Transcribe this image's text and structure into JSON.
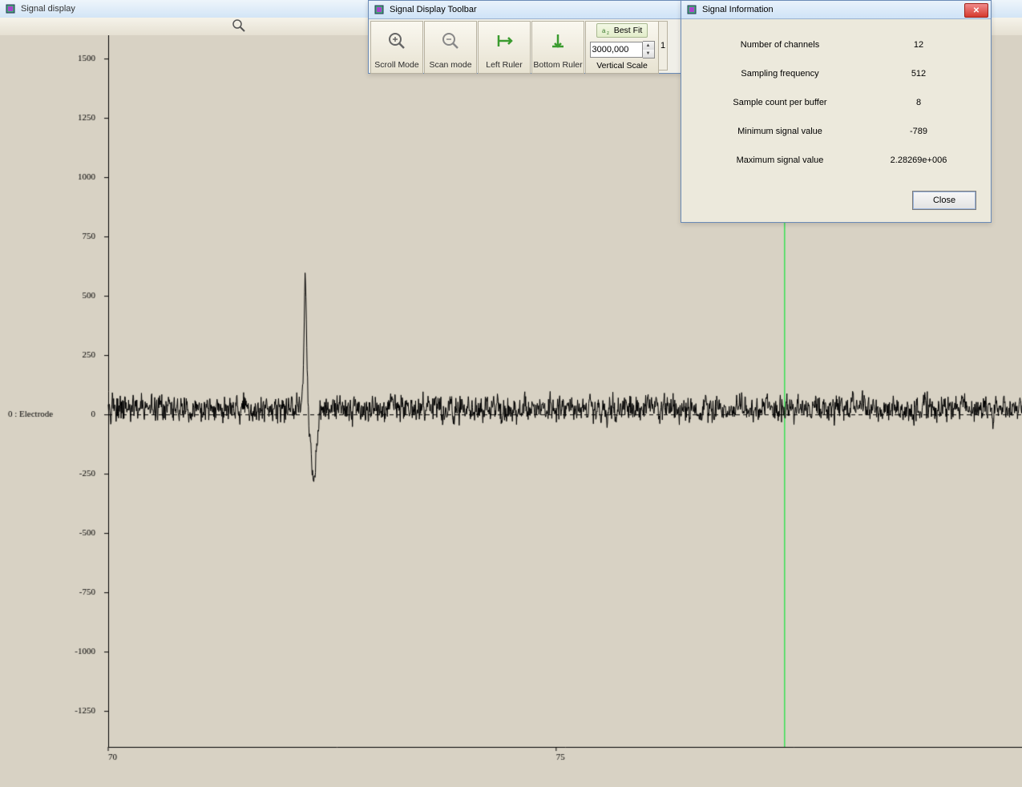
{
  "main_window": {
    "title": "Signal display",
    "channel_label": "0 : Electrode"
  },
  "toolbar_window": {
    "title": "Signal Display Toolbar",
    "scroll_mode": "Scroll Mode",
    "scan_mode": "Scan mode",
    "left_ruler": "Left Ruler",
    "bottom_ruler": "Bottom Ruler",
    "best_fit": "Best Fit",
    "vertical_scale": "Vertical Scale",
    "vscale_value": "3000,000",
    "partial_value": "1"
  },
  "info_window": {
    "title": "Signal Information",
    "rows": [
      {
        "label": "Number of channels",
        "value": "12"
      },
      {
        "label": "Sampling frequency",
        "value": "512"
      },
      {
        "label": "Sample count per buffer",
        "value": "8"
      },
      {
        "label": "Minimum signal value",
        "value": "-789"
      },
      {
        "label": "Maximum signal value",
        "value": "2.28269e+006"
      }
    ],
    "close": "Close"
  },
  "chart_data": {
    "type": "line",
    "title": "",
    "xlabel": "",
    "ylabel": "",
    "x_ticks": [
      70,
      75
    ],
    "y_ticks": [
      1500,
      1250,
      1000,
      750,
      500,
      250,
      0,
      -250,
      -500,
      -750,
      -1000,
      -1250
    ],
    "ylim": [
      -1400,
      1600
    ],
    "xlim": [
      70,
      80.2
    ],
    "cursor_x": 77.55,
    "signal": {
      "description": "Single-channel EEG electrode trace. Baseline noise oscillates roughly between -100 and +150 amplitude units across the full visible time span (x≈70 to x≈80.2). A single large artifact/spike event occurs near x≈72.2: a sharp positive peak to about +530, immediately followed by a negative trough to about -280, then return to baseline noise. No other events; remainder is stationary noise of similar amplitude.",
      "noise_band": [
        -100,
        150
      ],
      "event": {
        "x": 72.2,
        "peak": 530,
        "trough": -280
      }
    }
  }
}
